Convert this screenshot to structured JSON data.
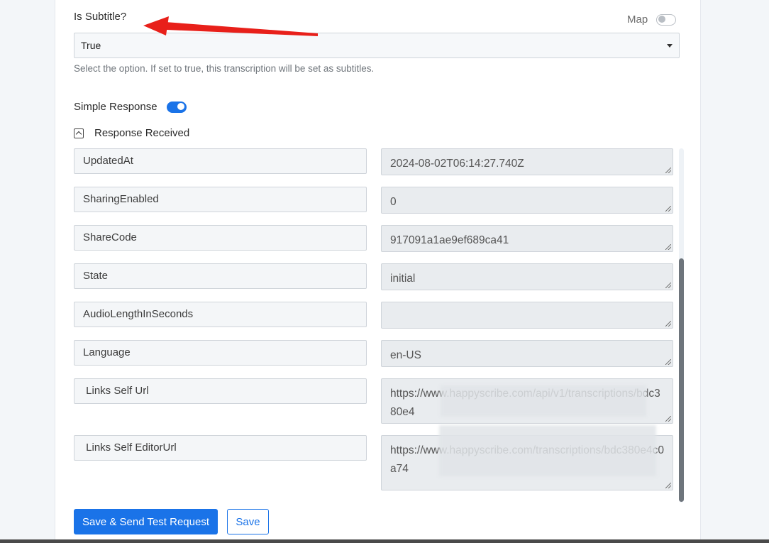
{
  "subtitle_field": {
    "label": "Is Subtitle?",
    "map_label": "Map",
    "map_toggle_on": false,
    "selected_value": "True",
    "helper_text": "Select the option.  If set to true, this transcription will be set as subtitles."
  },
  "simple_response": {
    "label": "Simple Response",
    "toggle_on": true
  },
  "response_received": {
    "label": "Response Received",
    "rows": [
      {
        "key": "UpdatedAt",
        "value": "2024-08-02T06:14:27.740Z"
      },
      {
        "key": "SharingEnabled",
        "value": "0"
      },
      {
        "key": "ShareCode",
        "value": "917091a1ae9ef689ca41"
      },
      {
        "key": "State",
        "value": "initial"
      },
      {
        "key": "AudioLengthInSeconds",
        "value": ""
      },
      {
        "key": "Language",
        "value": "en-US"
      },
      {
        "key": " Links Self Url",
        "value": "https://www.happyscribe.com/api/v1/transcriptions/bdc380e4"
      },
      {
        "key": " Links Self EditorUrl",
        "value": "https://www.happyscribe.com/transcriptions/bdc380e4c0a74"
      }
    ]
  },
  "buttons": {
    "save_send": "Save & Send Test Request",
    "save": "Save"
  },
  "colors": {
    "accent": "#1a73e8",
    "annotation_arrow": "#e8201a"
  }
}
